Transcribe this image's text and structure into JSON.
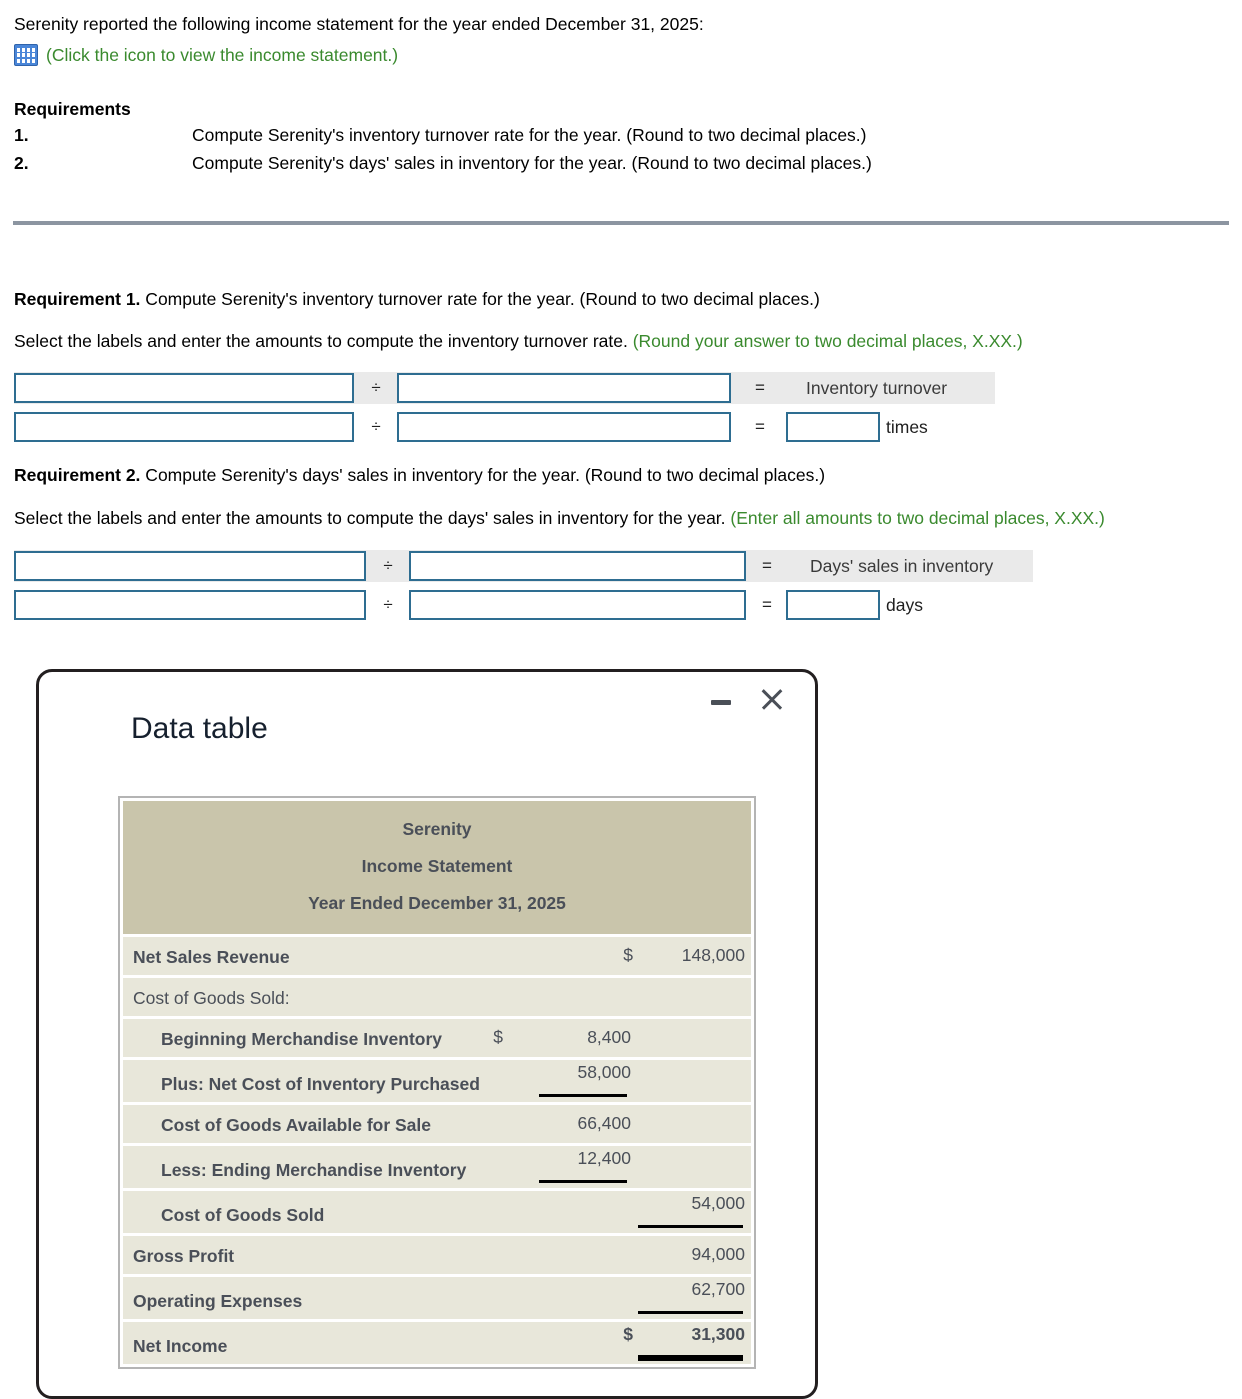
{
  "intro": {
    "statement": "Serenity reported the following income statement for the year ended December 31, 2025:",
    "icon_name": "table-grid-icon",
    "icon_link_text": "(Click the icon to view the income statement.)"
  },
  "requirements": {
    "heading": "Requirements",
    "items": [
      {
        "num": "1.",
        "text": "Compute Serenity's inventory turnover rate for the year. (Round to two decimal places.)"
      },
      {
        "num": "2.",
        "text": "Compute Serenity's days' sales in inventory for the year. (Round to two decimal places.)"
      }
    ]
  },
  "requirement1": {
    "label": "Requirement 1.",
    "title": " Compute Serenity's inventory turnover rate for the year. (Round to two decimal places.)",
    "instruction": "Select the labels and enter the amounts to compute the inventory turnover rate. ",
    "hint": "(Round your answer to two decimal places, X.XX.)",
    "operator": "÷",
    "equals": "=",
    "result_label": "Inventory turnover",
    "unit": "times",
    "fields": {
      "numerator_label": "",
      "denominator_label": "",
      "numerator_value": "",
      "denominator_value": "",
      "answer": ""
    }
  },
  "requirement2": {
    "label": "Requirement 2.",
    "title": " Compute Serenity's days' sales in inventory for the year. (Round to two decimal places.)",
    "instruction": "Select the labels and enter the amounts to compute the days' sales in inventory for the year. ",
    "hint": "(Enter all amounts to two decimal places, X.XX.)",
    "operator": "÷",
    "equals": "=",
    "result_label": "Days' sales in inventory",
    "unit": "days",
    "fields": {
      "numerator_label": "",
      "denominator_label": "",
      "numerator_value": "",
      "denominator_value": "",
      "answer": ""
    }
  },
  "dialog": {
    "title": "Data table",
    "minimize_icon": "minimize-icon",
    "close_icon": "close-icon",
    "table": {
      "header": {
        "company": "Serenity",
        "statement": "Income Statement",
        "period": "Year Ended December 31, 2025"
      },
      "rows": [
        {
          "label": "Net Sales Revenue",
          "indent": 0,
          "bold": true,
          "col": "out",
          "dollar": "$",
          "amount": "148,000",
          "rule": "none"
        },
        {
          "label": "Cost of Goods Sold:",
          "indent": 0,
          "bold": false,
          "col": "none",
          "dollar": "",
          "amount": "",
          "rule": "none"
        },
        {
          "label": "Beginning Merchandise Inventory",
          "indent": 1,
          "bold": true,
          "col": "in",
          "dollar": "$",
          "amount": "8,400",
          "rule": "none"
        },
        {
          "label": "Plus: Net Cost of Inventory Purchased",
          "indent": 1,
          "bold": true,
          "col": "in",
          "dollar": "",
          "amount": "58,000",
          "rule": "in"
        },
        {
          "label": "Cost of Goods Available for Sale",
          "indent": 1,
          "bold": true,
          "col": "in",
          "dollar": "",
          "amount": "66,400",
          "rule": "none"
        },
        {
          "label": "Less: Ending Merchandise Inventory",
          "indent": 1,
          "bold": true,
          "col": "in",
          "dollar": "",
          "amount": "12,400",
          "rule": "in"
        },
        {
          "label": "Cost of Goods Sold",
          "indent": 1,
          "bold": true,
          "col": "out",
          "dollar": "",
          "amount": "54,000",
          "rule": "out"
        },
        {
          "label": "Gross Profit",
          "indent": 0,
          "bold": true,
          "col": "out",
          "dollar": "",
          "amount": "94,000",
          "rule": "none"
        },
        {
          "label": "Operating Expenses",
          "indent": 0,
          "bold": true,
          "col": "out",
          "dollar": "",
          "amount": "62,700",
          "rule": "out"
        },
        {
          "label": "Net Income",
          "indent": 0,
          "bold": true,
          "col": "out",
          "dollar": "$",
          "amount": "31,300",
          "rule": "out-thick"
        }
      ]
    }
  },
  "colors": {
    "field_border": "#2e6d91",
    "hint_green": "#3a8a2e",
    "band_gray": "#eaeaea",
    "table_header_bg": "#c9c5ab",
    "table_row_bg": "#e8e7da",
    "rule_gray": "#8c95a1"
  }
}
